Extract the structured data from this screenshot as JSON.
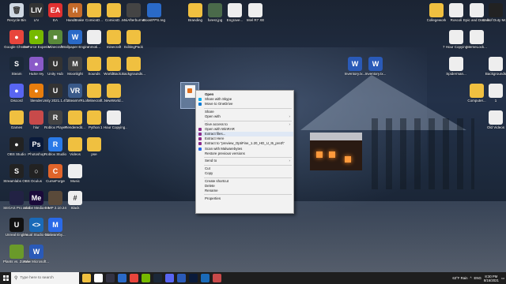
{
  "desktop": {
    "icons": [
      {
        "label": "Recycle Bin",
        "color": "#cfd8e3",
        "glyph": "🗑"
      },
      {
        "label": "LIV",
        "color": "#333333",
        "glyph": "LIV"
      },
      {
        "label": "EA",
        "color": "#e03030",
        "glyph": "EA"
      },
      {
        "label": "HandBrake",
        "color": "#c46a2a",
        "glyph": "H"
      },
      {
        "label": "ComicsD...",
        "color": "#f0c040",
        "glyph": ""
      },
      {
        "label": "ComicsD...",
        "color": "#f0c040",
        "glyph": ""
      },
      {
        "label": "MsiAfterburner",
        "color": "#444444",
        "glyph": ""
      },
      {
        "label": "BoostFPS.reg",
        "color": "#2a6ac8",
        "glyph": ""
      },
      {
        "label": "Branding",
        "color": "#f0c040",
        "glyph": ""
      },
      {
        "label": "forest.jpg",
        "color": "#4a6a4a",
        "glyph": ""
      },
      {
        "label": "Engrave...",
        "color": "#eeeeee",
        "glyph": ""
      },
      {
        "label": "Intel R7 XE",
        "color": "#eeeeee",
        "glyph": ""
      },
      {
        "label": "Collegework",
        "color": "#f0c040",
        "glyph": ""
      },
      {
        "label": "Roscoli",
        "color": "#eeeeee",
        "glyph": ""
      },
      {
        "label": "Epic and Dramatic S...",
        "color": "#eeeeee",
        "glyph": ""
      },
      {
        "label": "Call of Duty Modern...",
        "color": "#222222",
        "glyph": ""
      },
      {
        "label": "Google Chrome",
        "color": "#e8453c",
        "glyph": "●"
      },
      {
        "label": "GeForce Experience",
        "color": "#76b900",
        "glyph": "●"
      },
      {
        "label": "Minecraft",
        "color": "#5a8a3a",
        "glyph": "■"
      },
      {
        "label": "Wallpaper Engine",
        "color": "#2a6ac8",
        "glyph": "W"
      },
      {
        "label": "mmoti...",
        "color": "#eeeeee",
        "glyph": ""
      },
      {
        "label": "minecraft",
        "color": "#f0c040",
        "glyph": ""
      },
      {
        "label": "EditingPack",
        "color": "#f0c040",
        "glyph": ""
      },
      {
        "label": "7 Hour Copying...",
        "color": "#eeeeee",
        "glyph": ""
      },
      {
        "label": "MemeLock...",
        "color": "#eeeeee",
        "glyph": ""
      },
      {
        "label": "Steam",
        "color": "#1b2838",
        "glyph": "S"
      },
      {
        "label": "HuSe rey",
        "color": "#8a5ac8",
        "glyph": "●"
      },
      {
        "label": "Unity Hub",
        "color": "#333333",
        "glyph": "U"
      },
      {
        "label": "Moonlight",
        "color": "#444444",
        "glyph": "M"
      },
      {
        "label": "Sounds",
        "color": "#f0c040",
        "glyph": ""
      },
      {
        "label": "WorldBack...",
        "color": "#f0c040",
        "glyph": ""
      },
      {
        "label": "Backgrounds...",
        "color": "#f0c040",
        "glyph": ""
      },
      {
        "label": "Inventory.tx...",
        "color": "#2a5ab8",
        "glyph": "W"
      },
      {
        "label": "Inventory.tx...",
        "color": "#2a5ab8",
        "glyph": "W"
      },
      {
        "label": "Spiderman...",
        "color": "#eeeeee",
        "glyph": ""
      },
      {
        "label": "Backgrounds",
        "color": "#eeeeee",
        "glyph": ""
      },
      {
        "label": "Discord",
        "color": "#5865f2",
        "glyph": "●"
      },
      {
        "label": "blender",
        "color": "#e87d0d",
        "glyph": "●"
      },
      {
        "label": "Unity 2021.1.4f1",
        "color": "#333333",
        "glyph": "U"
      },
      {
        "label": "SteamVR",
        "color": "#3a5a8a",
        "glyph": "VR"
      },
      {
        "label": "LolMinecraft...",
        "color": "#f0c040",
        "glyph": ""
      },
      {
        "label": "NewWorld...",
        "color": "#f0c040",
        "glyph": ""
      },
      {
        "label": "Computer...",
        "color": "#f0c040",
        "glyph": ""
      },
      {
        "label": "1",
        "color": "#eeeeee",
        "glyph": ""
      },
      {
        "label": "Games",
        "color": "#f0c040",
        "glyph": ""
      },
      {
        "label": "hlur",
        "color": "#c84a4a",
        "glyph": ""
      },
      {
        "label": "Roblox Player",
        "color": "#444444",
        "glyph": "R"
      },
      {
        "label": "Renderedit...",
        "color": "#f0c040",
        "glyph": ""
      },
      {
        "label": "Python",
        "color": "#f0c040",
        "glyph": ""
      },
      {
        "label": "1 Hour Copying...",
        "color": "#eeeeee",
        "glyph": ""
      },
      {
        "label": "Old Videos",
        "color": "#eeeeee",
        "glyph": ""
      },
      {
        "label": "OBS Studio",
        "color": "#222222",
        "glyph": "●"
      },
      {
        "label": "Photoshop",
        "color": "#0a1a3a",
        "glyph": "Ps"
      },
      {
        "label": "Roblox Studio",
        "color": "#2a7ae8",
        "glyph": "R"
      },
      {
        "label": "Videos",
        "color": "#f0c040",
        "glyph": ""
      },
      {
        "label": "pse",
        "color": "#f0c040",
        "glyph": ""
      },
      {
        "label": "Streamlabs OBS",
        "color": "#222222",
        "glyph": "S"
      },
      {
        "label": "Oculus",
        "color": "#222222",
        "glyph": "○"
      },
      {
        "label": "CurseForge",
        "color": "#e0642a",
        "glyph": "C"
      },
      {
        "label": "Music",
        "color": "#eeeeee",
        "glyph": ""
      },
      {
        "label": "SEGAS Pro 15.0",
        "color": "#222244",
        "glyph": ""
      },
      {
        "label": "Adobe Media Encoder 2021",
        "color": "#1a0a3a",
        "glyph": "Me"
      },
      {
        "label": "GIMP 2.10.24",
        "color": "#5a4a3a",
        "glyph": ""
      },
      {
        "label": "Slack",
        "color": "#eeeeee",
        "glyph": "#"
      },
      {
        "label": "Unreal Engine",
        "color": "#111111",
        "glyph": "U"
      },
      {
        "label": "Visual Studio Code",
        "color": "#1a6ab8",
        "glyph": "<>"
      },
      {
        "label": "Malwareby...",
        "color": "#2a6ae8",
        "glyph": "M"
      },
      {
        "label": "Plants vs. Zombies Ba...",
        "color": "#6a9a2a",
        "glyph": ""
      },
      {
        "label": "New Microsoft...",
        "color": "#2a5ab8",
        "glyph": "W"
      }
    ]
  },
  "selected_file": {
    "name": "preview_OptiFine_1.20_HD_U_I5_pre3"
  },
  "context_menu": {
    "items": [
      {
        "label": "Open",
        "bold": true,
        "icon": "",
        "arrow": false
      },
      {
        "label": "Share with Skype",
        "icon": "#00aff0",
        "arrow": false
      },
      {
        "label": "Move to OneDrive",
        "icon": "#0078d4",
        "arrow": false
      },
      {
        "sep": true
      },
      {
        "label": "Share",
        "icon": "",
        "arrow": false
      },
      {
        "label": "Open with",
        "icon": "",
        "arrow": true
      },
      {
        "sep": true
      },
      {
        "label": "Give access to",
        "icon": "",
        "arrow": true
      },
      {
        "label": "Open with WinRAR",
        "icon": "#8a2a8a",
        "arrow": false
      },
      {
        "label": "Extract files...",
        "icon": "#8a2a8a",
        "arrow": false,
        "highlight": true
      },
      {
        "label": "Extract Here",
        "icon": "#8a2a8a",
        "arrow": false
      },
      {
        "label": "Extract to \"preview_OptiFine_1.20_HD_U_I5_pre3\\\"",
        "icon": "#8a2a8a",
        "arrow": false
      },
      {
        "label": "Scan with Malwarebytes",
        "icon": "#2a6ae8",
        "arrow": false
      },
      {
        "label": "Restore previous versions",
        "icon": "",
        "arrow": false
      },
      {
        "sep": true
      },
      {
        "label": "Send to",
        "icon": "",
        "arrow": true
      },
      {
        "sep": true
      },
      {
        "label": "Cut",
        "icon": "",
        "arrow": false
      },
      {
        "label": "Copy",
        "icon": "",
        "arrow": false
      },
      {
        "sep": true
      },
      {
        "label": "Create shortcut",
        "icon": "",
        "arrow": false
      },
      {
        "label": "Delete",
        "icon": "",
        "arrow": false
      },
      {
        "label": "Rename",
        "icon": "",
        "arrow": false
      },
      {
        "sep": true
      },
      {
        "label": "Properties",
        "icon": "",
        "arrow": false
      }
    ]
  },
  "taskbar": {
    "search_placeholder": "Type here to search",
    "apps": [
      "#f0c040",
      "#ffffff",
      "#333344",
      "#2a6ac8",
      "#e8453c",
      "#76b900",
      "#1b2838",
      "#5865f2",
      "#2a5ab8",
      "#0a1a3a",
      "#1a6ab8",
      "#c84a4a"
    ],
    "weather": "63°F Rain",
    "language": "ENG",
    "time": "8:30 PM",
    "date": "8/16/2021"
  }
}
